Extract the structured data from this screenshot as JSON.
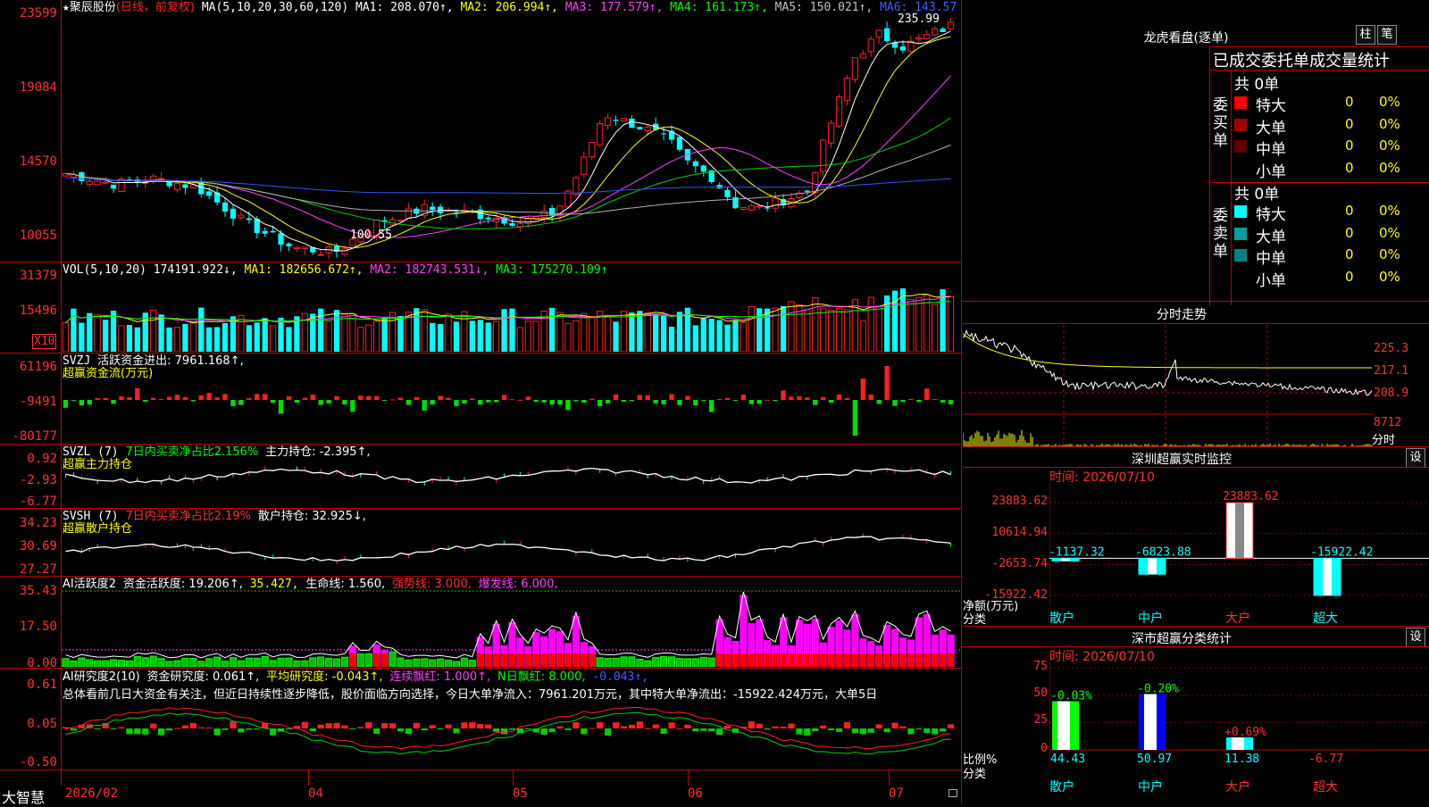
{
  "main_chart": {
    "star": "★",
    "stock_name": "聚辰股份",
    "mode": "(日线，前复权)",
    "ma_params": "MA(5,10,20,30,60,120)",
    "ma1": "MA1: 208.070↑,",
    "ma2": "MA2: 206.994↑,",
    "ma3": "MA3: 177.579↑,",
    "ma4": "MA4: 161.173↑,",
    "ma5": "MA5: 150.021↑,",
    "ma6": "MA6: 143.57",
    "y_ticks": [
      "23599",
      "19084",
      "14570",
      "10055"
    ],
    "high_label": "235.99",
    "low_label": "100.55"
  },
  "vol_panel": {
    "title": "VOL(5,10,20)",
    "value": "174191.922↓,",
    "ma1": "MA1: 182656.672↑,",
    "ma2": "MA2: 182743.531↓,",
    "ma3": "MA3: 175270.109↑",
    "y_ticks": [
      "31379",
      "15496"
    ],
    "unit": "X10"
  },
  "svzj_panel": {
    "title": "SVZJ",
    "text": "活跃资金进出: 7961.168↑,",
    "sub": "超赢资金流(万元)",
    "y_ticks": [
      "61196",
      "-9491",
      "-80177"
    ]
  },
  "svzl_panel": {
    "title": "SVZL (7)",
    "text1": "7日内买卖净占比2.156%",
    "text2": "主力持仓: -2.395↑,",
    "sub": "超赢主力持仓",
    "y_ticks": [
      "0.92",
      "-2.93",
      "-6.77"
    ]
  },
  "svsh_panel": {
    "title": "SVSH (7)",
    "text1": "7日内买卖净占比2.19%",
    "text2": "散户持仓: 32.925↓,",
    "sub": "超赢散户持仓",
    "y_ticks": [
      "34.23",
      "30.69",
      "27.27"
    ]
  },
  "ai_active_panel": {
    "title": "AI活跃度2",
    "t1": "资金活跃度: 19.206↑,",
    "t2": "35.427,",
    "t3": "生命线: 1.560,",
    "t4": "强势线: 3.000,",
    "t5": "爆发线: 6.000,",
    "y_ticks": [
      "35.43",
      "17.50",
      "0.00"
    ]
  },
  "ai_research_panel": {
    "title": "AI研究度2(10)",
    "t1": "资金研究度: 0.061↑,",
    "t2": "平均研究度: -0.043↑,",
    "t3": "连续飘红: 1.000↑,",
    "t4": "N日飘红: 8.000,",
    "t5": "-0.043↑,",
    "summary": "总体看前几日大资金有关注，但近日持续性逐步降低，股价面临方向选择，今日大单净流入：7961.201万元，其中特大单净流出：-15922.424万元，大单5日",
    "y_ticks": [
      "0.61",
      "0.05",
      "-0.50"
    ]
  },
  "x_axis": {
    "brand": "大智慧",
    "labels": [
      "2026/02",
      "04",
      "05",
      "06",
      "07"
    ]
  },
  "lhb_panel": {
    "title": "龙虎看盘(逐单)",
    "btn_bar": "柱",
    "btn_pen": "笔",
    "subtitle": "已成交委托单成交量统计",
    "buy_label": "委买单",
    "sell_label": "委卖单",
    "buy_total": "共 0单",
    "sell_total": "共 0单",
    "buy_rows": [
      {
        "name": "特大",
        "count": "0",
        "pct": "0%",
        "color": "#ff0000"
      },
      {
        "name": "大单",
        "count": "0",
        "pct": "0%",
        "color": "#a00000"
      },
      {
        "name": "中单",
        "count": "0",
        "pct": "0%",
        "color": "#600000"
      },
      {
        "name": "小单",
        "count": "0",
        "pct": "0%",
        "color": "#000000"
      }
    ],
    "sell_rows": [
      {
        "name": "特大",
        "count": "0",
        "pct": "0%",
        "color": "#00ffff"
      },
      {
        "name": "大单",
        "count": "0",
        "pct": "0%",
        "color": "#00a0a0"
      },
      {
        "name": "中单",
        "count": "0",
        "pct": "0%",
        "color": "#008080"
      },
      {
        "name": "小单",
        "count": "0",
        "pct": "0%",
        "color": "#000000"
      }
    ]
  },
  "intraday_panel": {
    "title": "分时走势",
    "y_ticks": [
      "225.3",
      "217.1",
      "208.9"
    ],
    "vol_tick": "8712",
    "unit": "分时"
  },
  "sz_monitor": {
    "title": "深圳超赢实时监控",
    "btn": "设",
    "time": "时间: 2026/07/10",
    "y_ticks": [
      "23883.62",
      "10614.94",
      "-2653.74",
      "-15922.42"
    ],
    "y_caption": "净额(万元)",
    "x_caption": "分类",
    "categories": [
      "散户",
      "中户",
      "大户",
      "超大"
    ],
    "values": [
      -1137.32,
      -6823.88,
      23883.62,
      -15922.42
    ],
    "value_labels": [
      "-1137.32",
      "-6823.88",
      "23883.62",
      "-15922.42"
    ]
  },
  "sz_stats": {
    "title": "深市超赢分类统计",
    "btn": "设",
    "time": "时间: 2026/07/10",
    "y_ticks": [
      "75",
      "50",
      "25",
      "0"
    ],
    "y_caption": "比例%",
    "x_caption": "分类",
    "categories": [
      "散户",
      "中户",
      "大户",
      "超大"
    ],
    "values": [
      44.43,
      50.97,
      11.38,
      -6.77
    ],
    "value_labels": [
      "44.43",
      "50.97",
      "11.38",
      "-6.77"
    ],
    "change_labels": [
      "-0.03%",
      "-0.20%",
      "+0.69%",
      ""
    ]
  }
}
